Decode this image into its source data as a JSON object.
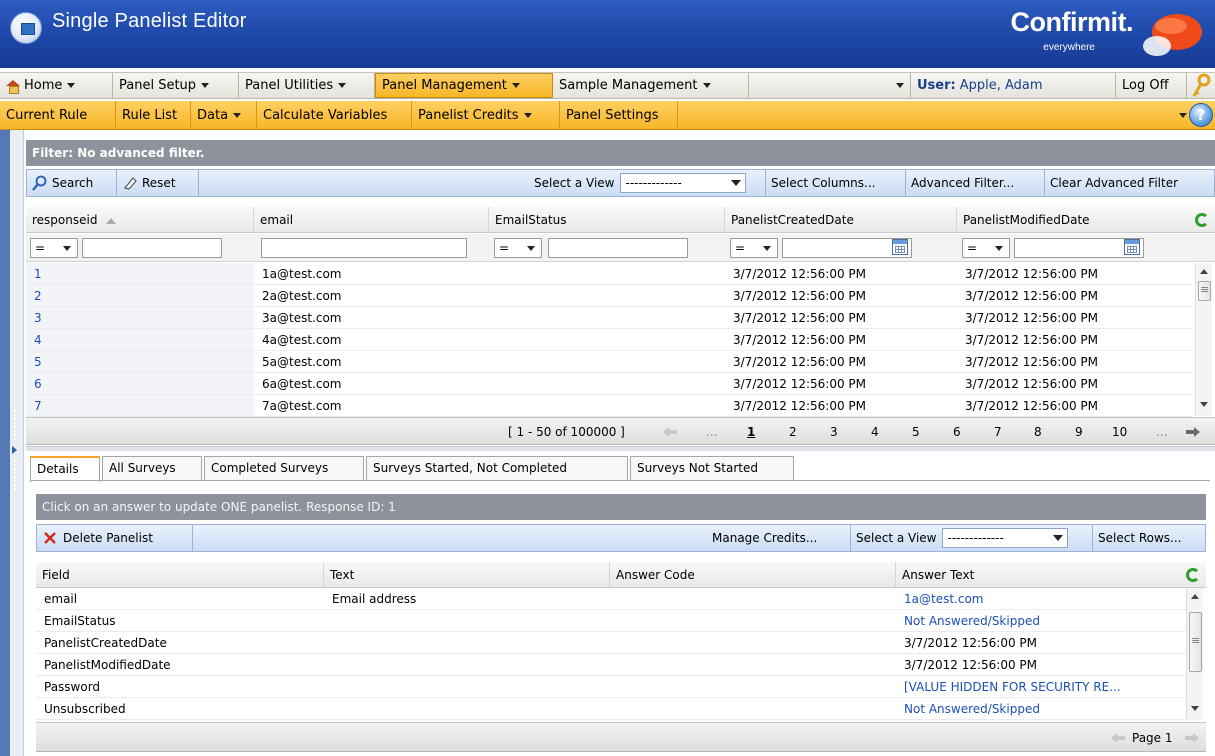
{
  "app": {
    "title": "Single Panelist Editor",
    "brand": "Confirmit.",
    "brand_tagline": "everywhere"
  },
  "colors": {
    "title_blue": "#1d47a8",
    "menu_orange": "#f7b628",
    "link_blue": "#1a4fb4",
    "filter_gray": "#8d929c"
  },
  "menu1": {
    "home": "Home",
    "panel_setup": "Panel Setup",
    "panel_utilities": "Panel Utilities",
    "panel_management": "Panel Management",
    "sample_management": "Sample Management",
    "user_label": "User:",
    "user_name": "Apple, Adam",
    "log_off": "Log Off"
  },
  "menu2": {
    "current_rule": "Current Rule",
    "rule_list": "Rule List",
    "data": "Data",
    "calculate_variables": "Calculate Variables",
    "panelist_credits": "Panelist Credits",
    "panel_settings": "Panel Settings"
  },
  "filter": {
    "text": "Filter: No advanced filter."
  },
  "toolbar": {
    "search": "Search",
    "reset": "Reset",
    "select_view_label": "Select a View",
    "select_view_value": "-------------",
    "select_columns": "Select Columns...",
    "advanced_filter": "Advanced Filter...",
    "clear_advanced_filter": "Clear Advanced Filter"
  },
  "grid": {
    "columns": [
      "responseid",
      "email",
      "EmailStatus",
      "PanelistCreatedDate",
      "PanelistModifiedDate"
    ],
    "operator": "=",
    "rows": [
      [
        "1",
        "1a@test.com",
        "",
        "3/7/2012 12:56:00 PM",
        "3/7/2012 12:56:00 PM"
      ],
      [
        "2",
        "2a@test.com",
        "",
        "3/7/2012 12:56:00 PM",
        "3/7/2012 12:56:00 PM"
      ],
      [
        "3",
        "3a@test.com",
        "",
        "3/7/2012 12:56:00 PM",
        "3/7/2012 12:56:00 PM"
      ],
      [
        "4",
        "4a@test.com",
        "",
        "3/7/2012 12:56:00 PM",
        "3/7/2012 12:56:00 PM"
      ],
      [
        "5",
        "5a@test.com",
        "",
        "3/7/2012 12:56:00 PM",
        "3/7/2012 12:56:00 PM"
      ],
      [
        "6",
        "6a@test.com",
        "",
        "3/7/2012 12:56:00 PM",
        "3/7/2012 12:56:00 PM"
      ],
      [
        "7",
        "7a@test.com",
        "",
        "3/7/2012 12:56:00 PM",
        "3/7/2012 12:56:00 PM"
      ]
    ]
  },
  "pager": {
    "range": "[ 1 - 50 of 100000 ]",
    "ellipsis_left": "...",
    "pages": [
      "1",
      "2",
      "3",
      "4",
      "5",
      "6",
      "7",
      "8",
      "9",
      "10"
    ],
    "current_page": "1",
    "ellipsis_right": "..."
  },
  "tabs": [
    "Details",
    "All Surveys",
    "Completed Surveys",
    "Surveys Started, Not Completed",
    "Surveys Not Started"
  ],
  "details": {
    "info": "Click on an answer to update ONE panelist. Response ID: 1",
    "delete_panelist": "Delete Panelist",
    "manage_credits": "Manage Credits...",
    "select_view_label": "Select a View",
    "select_view_value": "-------------",
    "select_rows": "Select Rows...",
    "columns": [
      "Field",
      "Text",
      "Answer Code",
      "Answer Text"
    ],
    "rows": [
      [
        "email",
        "Email address",
        "",
        "1a@test.com"
      ],
      [
        "EmailStatus",
        "",
        "",
        "Not Answered/Skipped"
      ],
      [
        "PanelistCreatedDate",
        "",
        "",
        "3/7/2012 12:56:00 PM"
      ],
      [
        "PanelistModifiedDate",
        "",
        "",
        "3/7/2012 12:56:00 PM"
      ],
      [
        "Password",
        "",
        "",
        "[VALUE HIDDEN FOR SECURITY RE..."
      ],
      [
        "Unsubscribed",
        "",
        "",
        "Not Answered/Skipped"
      ]
    ],
    "page_label": "Page 1"
  }
}
